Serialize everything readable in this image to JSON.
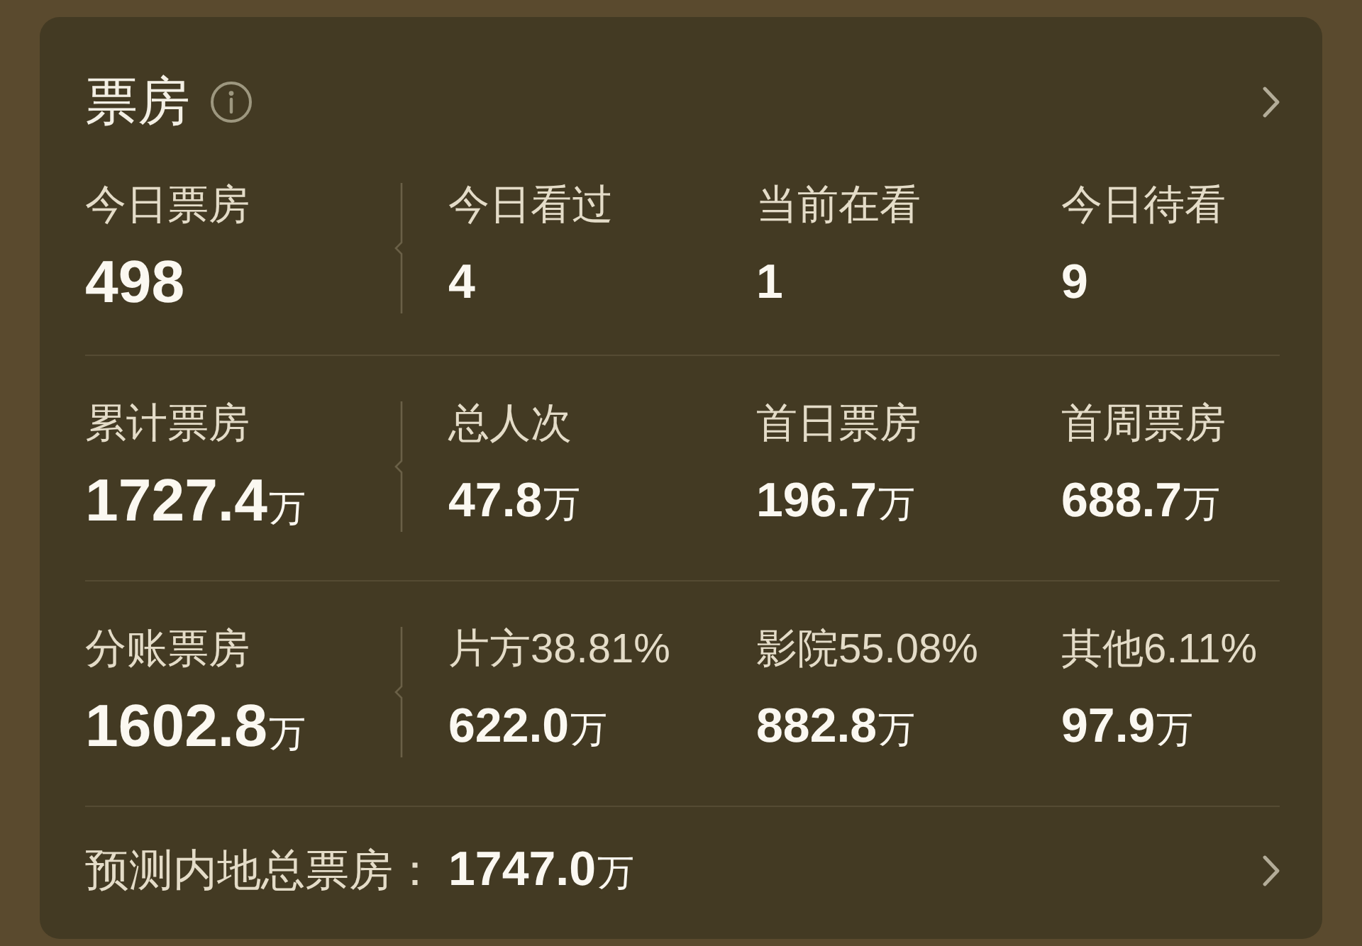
{
  "header": {
    "title": "票房"
  },
  "stat_rows": [
    {
      "cells": [
        {
          "label": "今日票房",
          "value": "498"
        },
        {
          "label": "今日看过",
          "value": "4"
        },
        {
          "label": "当前在看",
          "value": "1"
        },
        {
          "label": "今日待看",
          "value": "9"
        }
      ]
    },
    {
      "cells": [
        {
          "label": "累计票房",
          "value": "1727.4",
          "unit": "万"
        },
        {
          "label": "总人次",
          "value": "47.8",
          "unit": "万"
        },
        {
          "label": "首日票房",
          "value": "196.7",
          "unit": "万"
        },
        {
          "label": "首周票房",
          "value": "688.7",
          "unit": "万"
        }
      ]
    },
    {
      "cells": [
        {
          "label": "分账票房",
          "value": "1602.8",
          "unit": "万"
        },
        {
          "label": "片方38.81%",
          "value": "622.0",
          "unit": "万"
        },
        {
          "label": "影院55.08%",
          "value": "882.8",
          "unit": "万"
        },
        {
          "label": "其他6.11%",
          "value": "97.9",
          "unit": "万"
        }
      ]
    }
  ],
  "forecast": {
    "label": "预测内地总票房：",
    "value": "1747.0",
    "unit": "万"
  }
}
